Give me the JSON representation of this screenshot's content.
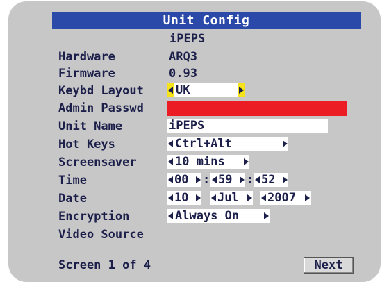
{
  "window": {
    "title": "Unit Config",
    "unit_id": "iPEPS"
  },
  "hardware": {
    "label": "Hardware",
    "value": "ARQ3"
  },
  "firmware": {
    "label": "Firmware",
    "value": "0.93"
  },
  "keyboard": {
    "label": "Keybd Layout",
    "value": "UK"
  },
  "admin_password": {
    "label": "Admin Passwd",
    "value": ""
  },
  "unit_name": {
    "label": "Unit Name",
    "value": "iPEPS"
  },
  "hot_keys": {
    "label": "Hot Keys",
    "value": "Ctrl+Alt"
  },
  "screensaver": {
    "label": "Screensaver",
    "value": "10 mins"
  },
  "time": {
    "label": "Time",
    "hours": "00",
    "minutes": "59",
    "seconds": "52",
    "separator": ":"
  },
  "date": {
    "label": "Date",
    "day": "10",
    "month": "Jul",
    "year": "2007"
  },
  "encryption": {
    "label": "Encryption",
    "value": "Always On"
  },
  "video_source": {
    "label": "Video Source"
  },
  "footer": {
    "page_indicator": "Screen 1 of 4",
    "next_label": "Next"
  },
  "colors": {
    "title_bar": "#2b49a8",
    "panel": "#c7c7c7",
    "focus_highlight": "#f4e21a",
    "password_field": "#ec1c24",
    "text": "#1c1f4a"
  },
  "icons": {
    "left_arrow": "left-arrow-icon",
    "right_arrow": "right-arrow-icon"
  }
}
